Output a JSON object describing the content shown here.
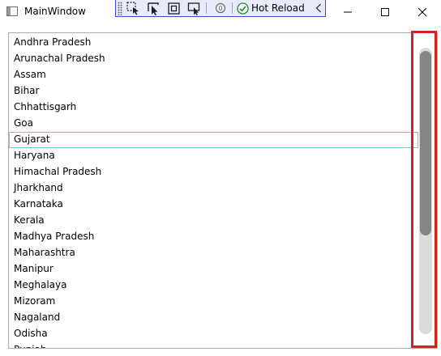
{
  "window": {
    "title": "MainWindow"
  },
  "icons": {
    "app": "app-window-icon",
    "select_element": "select-element-icon",
    "select_cursor": "pointer-icon",
    "display_layout": "layout-adorner-icon",
    "track_focus": "track-focus-icon",
    "binding_failures": "binding-failures-icon",
    "hot_reload_status": "check-circle-icon",
    "collapse": "chevron-left-icon",
    "minimize": "minimize-icon",
    "maximize": "maximize-icon",
    "close": "close-icon"
  },
  "toolbar": {
    "hot_reload_label": "Hot Reload",
    "accent_color": "#3a4cc8",
    "status_color": "#1a8a1a"
  },
  "list": {
    "selected_index": 6,
    "items": [
      "Andhra Pradesh",
      "Arunachal Pradesh",
      "Assam",
      "Bihar",
      "Chhattisgarh",
      "Goa",
      "Gujarat",
      "Haryana",
      "Himachal Pradesh",
      "Jharkhand",
      "Karnataka",
      "Kerala",
      "Madhya Pradesh",
      "Maharashtra",
      "Manipur",
      "Meghalaya",
      "Mizoram",
      "Nagaland",
      "Odisha",
      "Punjab"
    ]
  },
  "scrollbar": {
    "thumb_fraction": 0.66,
    "position_fraction": 0.0
  },
  "annotation": {
    "color": "#d42222"
  }
}
